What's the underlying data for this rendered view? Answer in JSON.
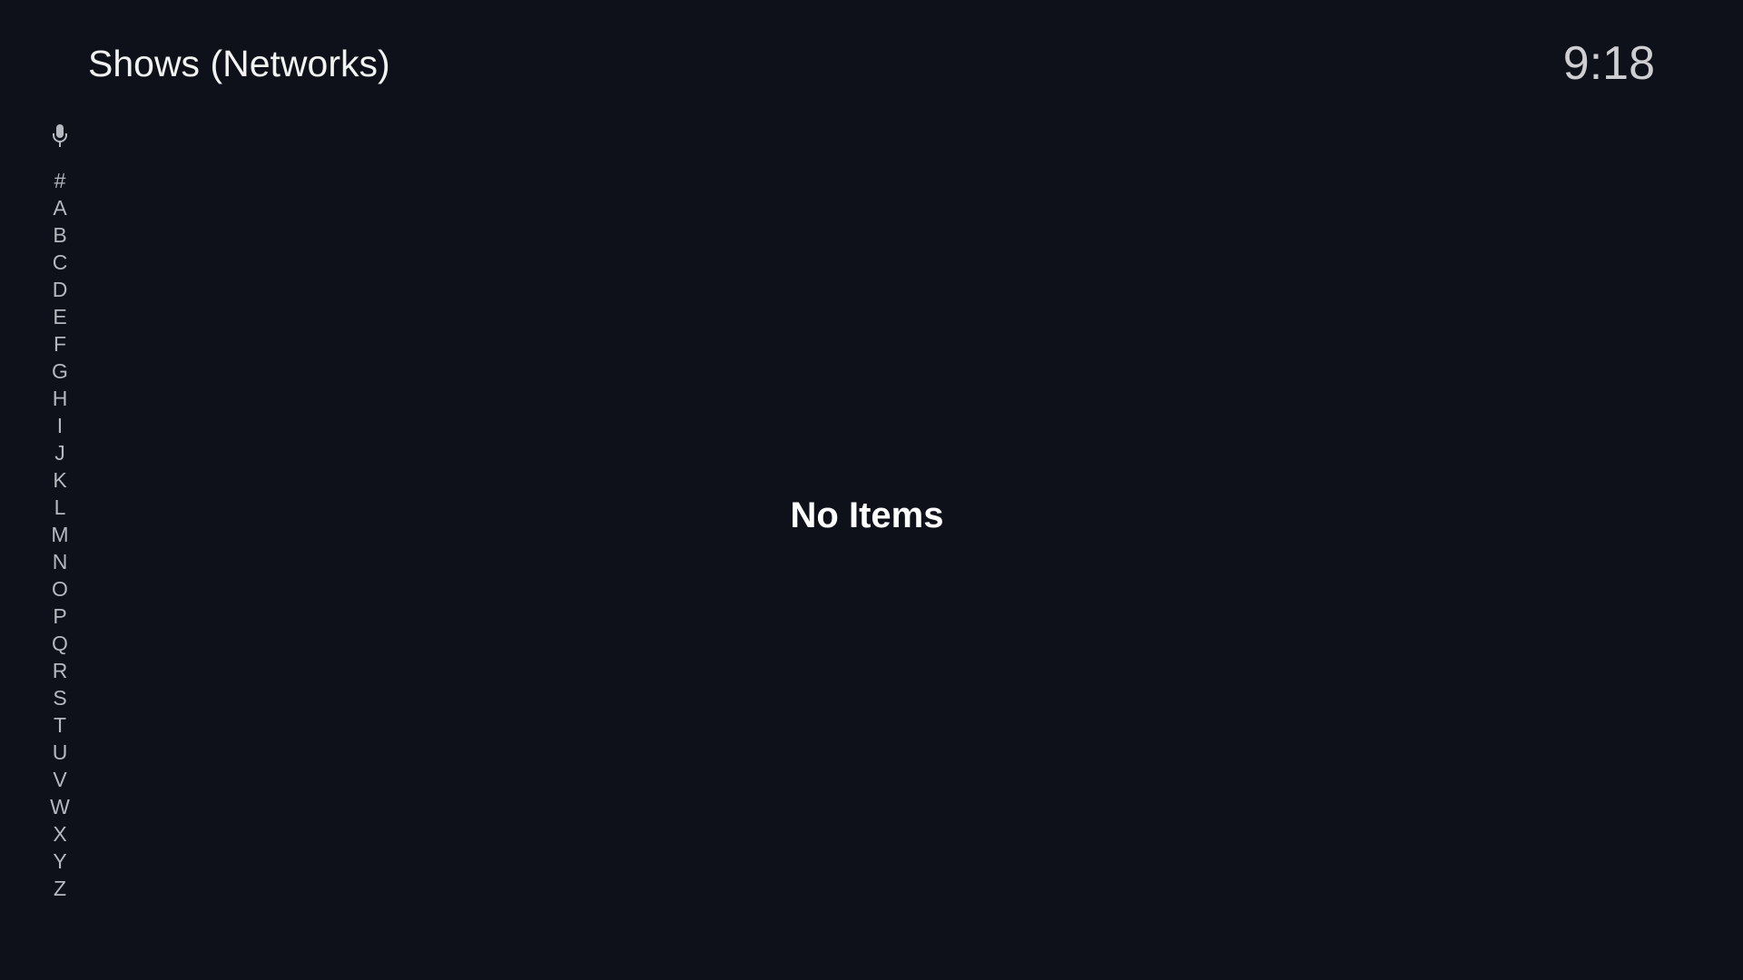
{
  "header": {
    "title": "Shows (Networks)",
    "clock": "9:18"
  },
  "alpha_index": {
    "voice_icon": "microphone-icon",
    "letters": [
      "#",
      "A",
      "B",
      "C",
      "D",
      "E",
      "F",
      "G",
      "H",
      "I",
      "J",
      "K",
      "L",
      "M",
      "N",
      "O",
      "P",
      "Q",
      "R",
      "S",
      "T",
      "U",
      "V",
      "W",
      "X",
      "Y",
      "Z"
    ]
  },
  "main": {
    "empty_message": "No Items"
  },
  "colors": {
    "background": "#0e111a",
    "title_text": "#f2f2f2",
    "clock_text": "#cfcfd3",
    "index_text": "#b6b8bf"
  }
}
